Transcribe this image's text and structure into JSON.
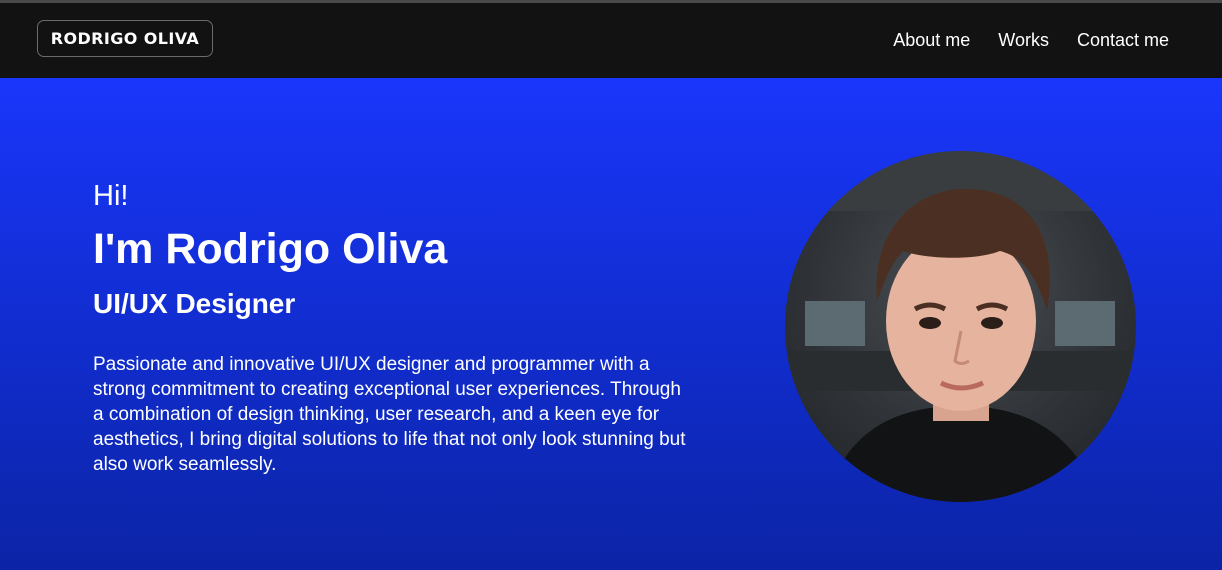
{
  "header": {
    "logo": "RODRIGO OLIVA",
    "nav": [
      {
        "label": "About me"
      },
      {
        "label": "Works"
      },
      {
        "label": "Contact me"
      }
    ]
  },
  "hero": {
    "greeting": "Hi!",
    "name": "I'm Rodrigo Oliva",
    "role": "UI/UX Designer",
    "bio": "Passionate and innovative UI/UX designer and programmer with a strong commitment to creating exceptional user experiences. Through a combination of design thinking, user research, and a keen eye for aesthetics, I bring digital solutions to life that not only look stunning but also work seamlessly."
  },
  "colors": {
    "navbar": "#121212",
    "hero_top": "#1a36fb",
    "hero_bottom": "#0b24a6",
    "text": "#ffffff"
  }
}
